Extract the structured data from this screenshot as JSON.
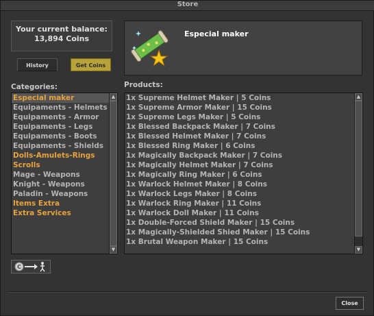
{
  "window": {
    "title": "Store"
  },
  "balance": {
    "line1": "Your current balance:",
    "line2": "13,894 Coins"
  },
  "tabs": {
    "history": "History",
    "get_coins": "Get Coins"
  },
  "selected_item": {
    "name": "Especial maker",
    "icon": "scroll-with-stars-icon"
  },
  "categories": {
    "label": "Categories:",
    "items": [
      {
        "label": "Especial maker",
        "highlight": true,
        "selected": true
      },
      {
        "label": "Equipaments - Helmets",
        "highlight": false
      },
      {
        "label": "Equipaments - Armor",
        "highlight": false
      },
      {
        "label": "Equipaments - Legs",
        "highlight": false
      },
      {
        "label": "Equipaments - Boots",
        "highlight": false
      },
      {
        "label": "Equipaments - Shields",
        "highlight": false
      },
      {
        "label": "Dolls-Amulets-Rings",
        "highlight": true
      },
      {
        "label": "Scrolls",
        "highlight": true
      },
      {
        "label": "Mage - Weapons",
        "highlight": false
      },
      {
        "label": "Knight - Weapons",
        "highlight": false
      },
      {
        "label": "Paladin - Weapons",
        "highlight": false
      },
      {
        "label": "Items Extra",
        "highlight": true
      },
      {
        "label": "Extra Services",
        "highlight": true
      }
    ]
  },
  "products": {
    "label": "Products:",
    "items": [
      "1x Supreme Helmet Maker | 5 Coins",
      "1x Supreme Armor Maker | 15 Coins",
      "1x Supreme Legs Maker | 5 Coins",
      "1x Blessed Backpack Maker | 7 Coins",
      "1x Blessed Helmet Maker | 7 Coins",
      "1x Blessed Ring Maker | 6 Coins",
      "1x Magically Backpack Maker | 7 Coins",
      "1x Magically Helmet Maker | 7 Coins",
      "1x Magically Ring Maker | 6 Coins",
      "1x Warlock Helmet Maker | 8 Coins",
      "1x Warlock Legs Maker | 8 Coins",
      "1x Warlock Ring Maker | 11 Coins",
      "1x Warlock Doll Maker | 11 Coins",
      "1x Double-Forced Shield Maker | 15 Coins",
      "1x Magically-Shielded Shied Maker | 15 Coins",
      "1x Brutal Weapon Maker | 15 Coins"
    ]
  },
  "buttons": {
    "close": "Close",
    "transfer_icon": "transfer-coins-icon"
  },
  "colors": {
    "highlight": "#e8a23c",
    "normal_text": "#b4b4b4",
    "get_coins_bg": "#b8a23a"
  }
}
